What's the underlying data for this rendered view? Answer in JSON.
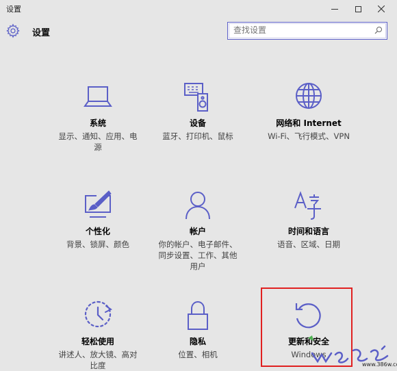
{
  "window": {
    "title": "设置"
  },
  "header": {
    "title": "设置"
  },
  "search": {
    "placeholder": "查找设置"
  },
  "tiles": [
    {
      "label": "系统",
      "desc": "显示、通知、应用、电源",
      "icon": "laptop-icon"
    },
    {
      "label": "设备",
      "desc": "蓝牙、打印机、鼠标",
      "icon": "devices-icon"
    },
    {
      "label": "网络和 Internet",
      "desc": "Wi-Fi、飞行模式、VPN",
      "icon": "globe-icon"
    },
    {
      "label": "个性化",
      "desc": "背景、锁屏、颜色",
      "icon": "personalization-icon"
    },
    {
      "label": "帐户",
      "desc": "你的帐户、电子邮件、同步设置、工作、其他用户",
      "icon": "person-icon"
    },
    {
      "label": "时间和语言",
      "desc": "语音、区域、日期",
      "icon": "time-language-icon"
    },
    {
      "label": "轻松使用",
      "desc": "讲述人、放大镜、高对比度",
      "icon": "ease-of-access-icon"
    },
    {
      "label": "隐私",
      "desc": "位置、相机",
      "icon": "lock-icon"
    },
    {
      "label": "更新和安全",
      "desc": "Windows",
      "icon": "update-icon"
    }
  ],
  "watermark": {
    "url": "www.386w.com"
  },
  "colors": {
    "accent": "#5b5fc7",
    "background": "#e6e6e6",
    "highlight": "#e02020"
  }
}
